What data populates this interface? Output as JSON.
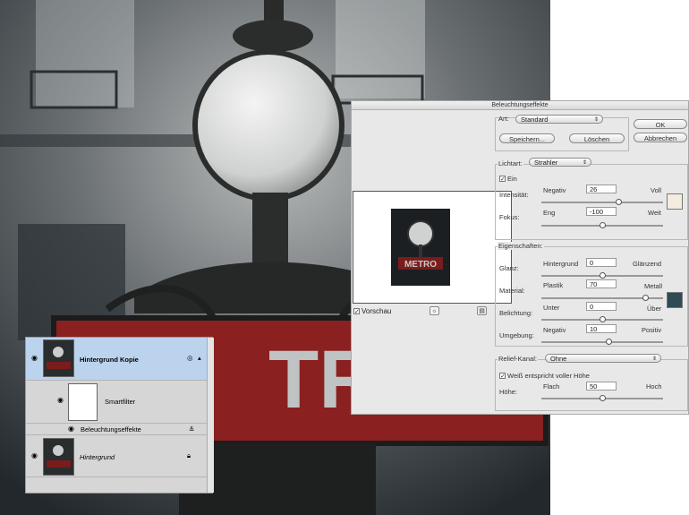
{
  "dialog": {
    "title": "Beleuchtungseffekte",
    "art_label": "Art:",
    "art_value": "Standard",
    "ok": "OK",
    "abbrechen": "Abbrechen",
    "speichern": "Speichern...",
    "loeschen": "Löschen",
    "vorschau": "Vorschau",
    "vorschau_checked": true,
    "lichtart": {
      "label": "Lichtart:",
      "value": "Strahler",
      "ein_label": "Ein",
      "ein_checked": true,
      "intensitaet": {
        "label": "Intensität:",
        "min": "Negativ",
        "max": "Voll",
        "value": "26",
        "fraction": 0.63
      },
      "fokus": {
        "label": "Fokus:",
        "min": "Eng",
        "max": "Weit",
        "value": "-100",
        "fraction": 0.5
      },
      "color": "#f5ece0"
    },
    "eigenschaften": {
      "label": "Eigenschaften:",
      "glanz": {
        "label": "Glanz:",
        "min": "Hintergrund",
        "max": "Glänzend",
        "value": "0",
        "fraction": 0.5
      },
      "material": {
        "label": "Material:",
        "min": "Plastik",
        "max": "Metall",
        "value": "70",
        "fraction": 0.85
      },
      "belichtung": {
        "label": "Belichtung:",
        "min": "Unter",
        "max": "Über",
        "value": "0",
        "fraction": 0.5
      },
      "umgebung": {
        "label": "Umgebung:",
        "min": "Negativ",
        "max": "Positiv",
        "value": "10",
        "fraction": 0.55
      },
      "color": "#2e4a55"
    },
    "relief": {
      "label": "Relief-Kanal:",
      "value": "Ohne",
      "weiss_label": "Weiß entspricht voller Höhe",
      "weiss_checked": true,
      "hoehe": {
        "label": "Höhe:",
        "min": "Flach",
        "max": "Hoch",
        "value": "50",
        "fraction": 0.5
      }
    }
  },
  "layers": {
    "items": [
      {
        "name": "Hintergrund Kopie"
      },
      {
        "name": "Smartfilter"
      },
      {
        "name": "Beleuchtungseffekte"
      },
      {
        "name": "Hintergrund"
      }
    ]
  },
  "photo": {
    "sign_text": "TRO",
    "preview_text": "METRO"
  }
}
